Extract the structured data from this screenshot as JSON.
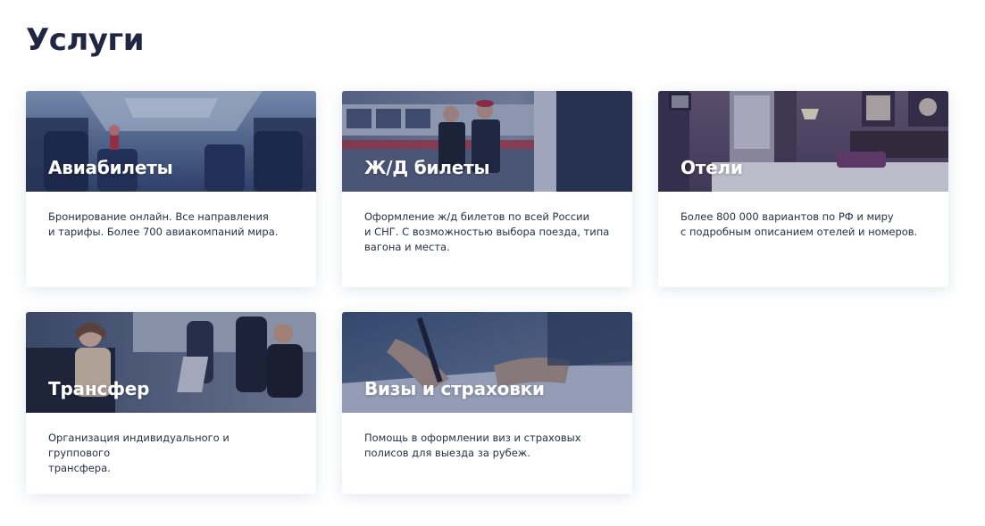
{
  "page": {
    "title": "Услуги"
  },
  "cards": [
    {
      "title": "Авиабилеты",
      "description": "Бронирование онлайн. Все направления\nи тарифы. Более 700 авиакомпаний мира.",
      "image": "airplane-cabin-image"
    },
    {
      "title": "Ж/Д билеты",
      "description": "Оформление ж/д билетов по всей России\nи СНГ. С возможностью выбора поезда, типа\nвагона и места.",
      "image": "train-platform-image"
    },
    {
      "title": "Отели",
      "description": "Более 800 000 вариантов по РФ и миру\nс подробным описанием отелей и номеров.",
      "image": "hotel-room-image"
    },
    {
      "title": "Трансфер",
      "description": "Организация индивидуального и группового\nтрансфера.",
      "image": "car-interior-image"
    },
    {
      "title": "Визы и страховки",
      "description": "Помощь в оформлении виз и страховых\nполисов для выезда за рубеж.",
      "image": "document-signing-image"
    }
  ],
  "colors": {
    "title_text": "#1f2744",
    "body_text": "#2a2f45",
    "card_background": "#ffffff",
    "image_overlay": "#1c2a5c"
  }
}
